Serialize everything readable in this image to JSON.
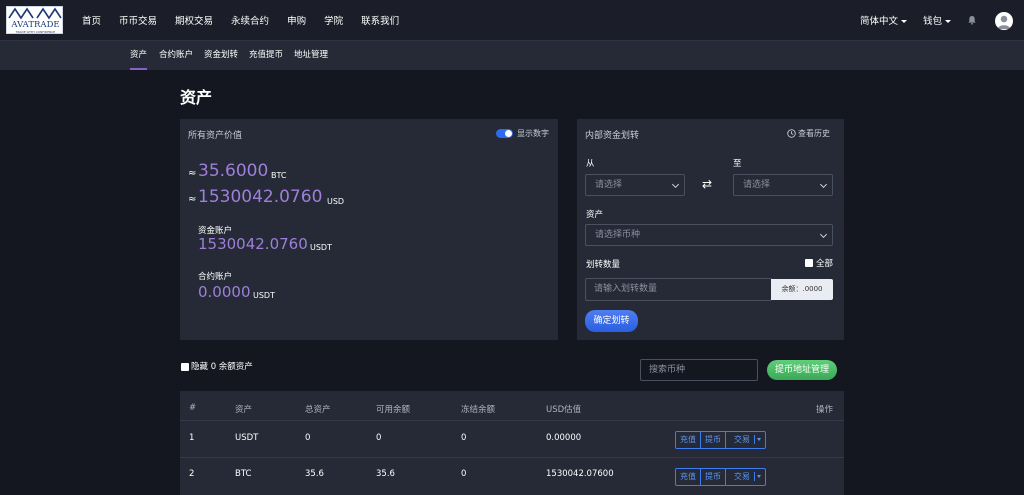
{
  "logo": {
    "brand": "AVATRADE",
    "tagline": "TRADE WITH CONFIDENCE"
  },
  "nav": {
    "items": [
      "首页",
      "币币交易",
      "期权交易",
      "永续合约",
      "申购",
      "学院",
      "联系我们"
    ]
  },
  "header_right": {
    "language": "简体中文",
    "wallet": "钱包"
  },
  "subnav": {
    "items": [
      "资产",
      "合约账户",
      "资金划转",
      "充值提币",
      "地址管理"
    ],
    "active": "资产"
  },
  "page": {
    "title": "资产"
  },
  "assets": {
    "header": "所有资产价值",
    "show_numbers_label": "显示数字",
    "approx": "≈",
    "btc_value": "35.6000",
    "btc_unit": "BTC",
    "usd_value": "1530042.0760",
    "usd_unit": "USD",
    "fund_account_label": "资金账户",
    "fund_account_value": "1530042.0760",
    "fund_account_unit": "USDT",
    "contract_account_label": "合约账户",
    "contract_account_value": "0.0000",
    "contract_account_unit": "USDT"
  },
  "transfer": {
    "header": "内部资金划转",
    "history_label": "查看历史",
    "from_label": "从",
    "to_label": "至",
    "select_placeholder": "请选择",
    "asset_label": "资产",
    "asset_placeholder": "请选择币种",
    "amount_label": "划转数量",
    "all_label": "全部",
    "amount_placeholder": "请输入划转数量",
    "balance_label": "余额：.0000",
    "confirm_label": "确定划转"
  },
  "filters": {
    "hide_zero_label": "隐藏 0 余额资产",
    "search_placeholder": "搜索币种",
    "withdraw_address_btn": "提币地址管理"
  },
  "table": {
    "headers": [
      "#",
      "资产",
      "总资产",
      "可用余额",
      "冻结余额",
      "USD估值",
      "操作"
    ],
    "rows": [
      {
        "index": "1",
        "asset": "USDT",
        "total": "0",
        "available": "0",
        "frozen": "0",
        "usd": "0.00000"
      },
      {
        "index": "2",
        "asset": "BTC",
        "total": "35.6",
        "available": "35.6",
        "frozen": "0",
        "usd": "1530042.07600"
      }
    ],
    "actions": {
      "deposit": "充值",
      "withdraw": "提币",
      "trade": "交易"
    }
  },
  "colors": {
    "accent_purple": "#9e7fd9",
    "primary_blue": "#2d6cf1",
    "success_green": "#3aa957",
    "bg": "#14171f",
    "panel": "#252a36"
  }
}
